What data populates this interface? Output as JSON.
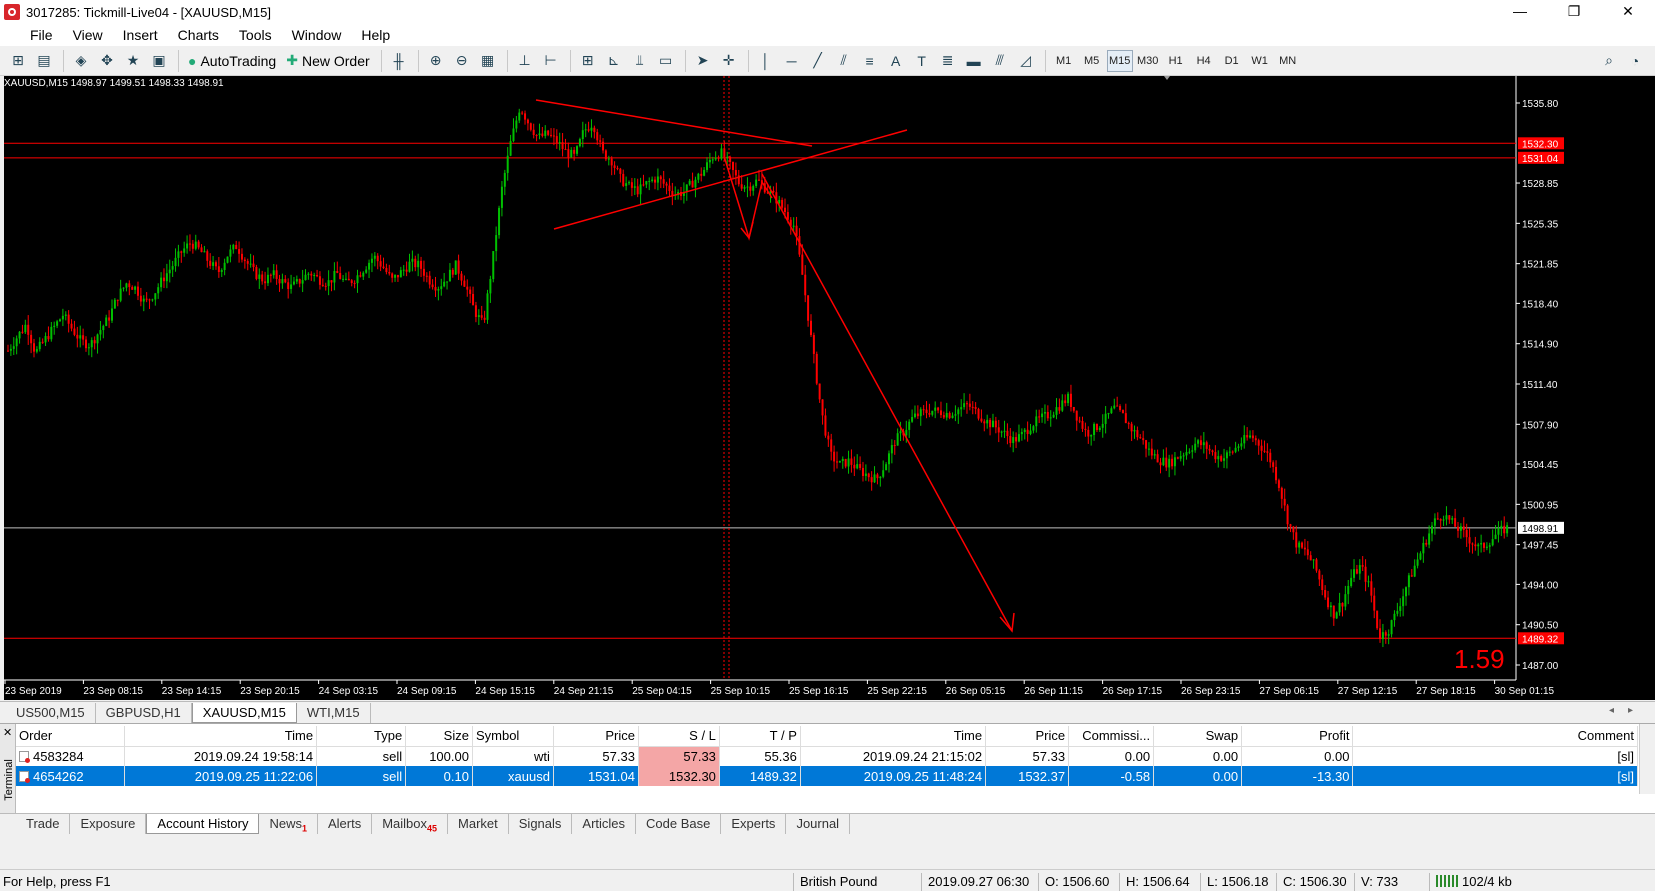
{
  "window": {
    "title": "3017285: Tickmill-Live04 - [XAUUSD,M15]",
    "controls": [
      "—",
      "❐",
      "✕"
    ]
  },
  "menu": [
    "File",
    "View",
    "Insert",
    "Charts",
    "Tools",
    "Window",
    "Help"
  ],
  "mdi_controls": [
    "–",
    "▫",
    "✕"
  ],
  "toolbar": {
    "autotrading_label": "AutoTrading",
    "new_order_label": "New Order",
    "timeframes": [
      "M1",
      "M5",
      "M15",
      "M30",
      "H1",
      "H4",
      "D1",
      "W1",
      "MN"
    ],
    "active_timeframe": "M15"
  },
  "chart": {
    "header": "XAUUSD,M15  1498.97 1499.51 1498.33 1498.91",
    "price_labels": [
      "1535.80",
      "1532.30",
      "1531.04",
      "1528.85",
      "1525.35",
      "1521.85",
      "1518.40",
      "1514.90",
      "1511.40",
      "1507.90",
      "1504.45",
      "1500.95",
      "1498.91",
      "1497.45",
      "1494.00",
      "1490.50",
      "1489.32",
      "1487.00"
    ],
    "time_labels": [
      "23 Sep 2019",
      "23 Sep 08:15",
      "23 Sep 14:15",
      "23 Sep 20:15",
      "24 Sep 03:15",
      "24 Sep 09:15",
      "24 Sep 15:15",
      "24 Sep 21:15",
      "25 Sep 04:15",
      "25 Sep 10:15",
      "25 Sep 16:15",
      "25 Sep 22:15",
      "26 Sep 05:15",
      "26 Sep 11:15",
      "26 Sep 17:15",
      "26 Sep 23:15",
      "27 Sep 06:15",
      "27 Sep 12:15",
      "27 Sep 18:15",
      "30 Sep 01:15"
    ],
    "annotation": "1.59",
    "colors": {
      "background": "#000000",
      "up": "#00c000",
      "down": "#ff0000",
      "level": "#ff0000",
      "current": "#c0c0c0"
    },
    "ohlc_path": [
      1514.3,
      1515.5,
      1516.6,
      1514.1,
      1515.2,
      1516.3,
      1517.4,
      1516.2,
      1515.1,
      1514.8,
      1516.0,
      1517.1,
      1519.0,
      1520.2,
      1519.7,
      1518.4,
      1519.3,
      1520.6,
      1521.7,
      1522.9,
      1523.7,
      1523.0,
      1522.0,
      1521.1,
      1522.6,
      1523.4,
      1522.1,
      1521.0,
      1520.4,
      1520.9,
      1520.3,
      1519.8,
      1520.4,
      1521.1,
      1520.5,
      1520.2,
      1521.0,
      1520.1,
      1520.6,
      1521.5,
      1522.5,
      1521.6,
      1520.4,
      1521.1,
      1521.9,
      1521.7,
      1520.5,
      1519.8,
      1520.6,
      1521.7,
      1520.1,
      1517.8,
      1516.5,
      1522.0,
      1528.2,
      1532.4,
      1535.5,
      1534.0,
      1532.8,
      1533.1,
      1532.5,
      1531.6,
      1531.1,
      1533.4,
      1534.1,
      1531.5,
      1530.9,
      1529.2,
      1528.5,
      1528.2,
      1528.9,
      1529.3,
      1528.6,
      1527.9,
      1528.1,
      1529.0,
      1529.8,
      1531.1,
      1531.5,
      1530.3,
      1528.8,
      1528.5,
      1529.1,
      1528.3,
      1527.5,
      1526.4,
      1525.1,
      1520.4,
      1514.5,
      1508.9,
      1505.2,
      1504.4,
      1504.7,
      1504.0,
      1503.5,
      1503.1,
      1504.5,
      1506.4,
      1507.3,
      1508.5,
      1508.9,
      1509.1,
      1509.0,
      1508.8,
      1509.2,
      1509.6,
      1508.9,
      1508.2,
      1507.7,
      1507.1,
      1506.5,
      1507.0,
      1507.9,
      1508.4,
      1508.8,
      1509.5,
      1510.2,
      1508.5,
      1507.1,
      1507.6,
      1508.3,
      1509.3,
      1508.6,
      1507.4,
      1506.6,
      1505.4,
      1504.8,
      1504.5,
      1505.1,
      1505.6,
      1506.3,
      1506.0,
      1505.2,
      1505.0,
      1505.6,
      1506.4,
      1506.9,
      1506.1,
      1505.0,
      1502.8,
      1499.6,
      1497.4,
      1496.8,
      1495.5,
      1493.2,
      1491.4,
      1492.5,
      1494.7,
      1495.6,
      1493.6,
      1489.5,
      1490.0,
      1491.8,
      1493.9,
      1495.8,
      1497.6,
      1499.4,
      1500.1,
      1499.3,
      1498.6,
      1497.8,
      1497.1,
      1497.7,
      1498.5,
      1498.9
    ]
  },
  "chart_tabs": [
    "US500,M15",
    "GBPUSD,H1",
    "XAUUSD,M15",
    "WTI,M15"
  ],
  "active_chart_tab": "XAUUSD,M15",
  "terminal": {
    "side_label": "Terminal",
    "headers": [
      "Order",
      "Time",
      "Type",
      "Size",
      "Symbol",
      "Price",
      "S / L",
      "T / P",
      "Time",
      "Price",
      "Commissi...",
      "Swap",
      "Profit",
      "Comment"
    ],
    "rows": [
      [
        "4583284",
        "2019.09.24 19:58:14",
        "sell",
        "100.00",
        "wti",
        "57.33",
        "57.33",
        "55.36",
        "2019.09.24 21:15:02",
        "57.33",
        "0.00",
        "0.00",
        "0.00",
        "[sl]"
      ],
      [
        "4654262",
        "2019.09.25 11:22:06",
        "sell",
        "0.10",
        "xauusd",
        "1531.04",
        "1532.30",
        "1489.32",
        "2019.09.25 11:48:24",
        "1532.37",
        "-0.58",
        "0.00",
        "-13.30",
        "[sl]"
      ]
    ],
    "tabs": [
      {
        "label": "Trade",
        "badge": ""
      },
      {
        "label": "Exposure",
        "badge": ""
      },
      {
        "label": "Account History",
        "badge": ""
      },
      {
        "label": "News",
        "badge": "1"
      },
      {
        "label": "Alerts",
        "badge": ""
      },
      {
        "label": "Mailbox",
        "badge": "45"
      },
      {
        "label": "Market",
        "badge": ""
      },
      {
        "label": "Signals",
        "badge": ""
      },
      {
        "label": "Articles",
        "badge": ""
      },
      {
        "label": "Code Base",
        "badge": ""
      },
      {
        "label": "Experts",
        "badge": ""
      },
      {
        "label": "Journal",
        "badge": ""
      }
    ],
    "active_tab": "Account History"
  },
  "status": {
    "help": "For Help, press F1",
    "profile": "British Pound",
    "time": "2019.09.27 06:30",
    "open": "O: 1506.60",
    "high": "H: 1506.64",
    "low": "L: 1506.18",
    "close": "C: 1506.30",
    "volume": "V: 733",
    "traffic": "102/4 kb"
  }
}
